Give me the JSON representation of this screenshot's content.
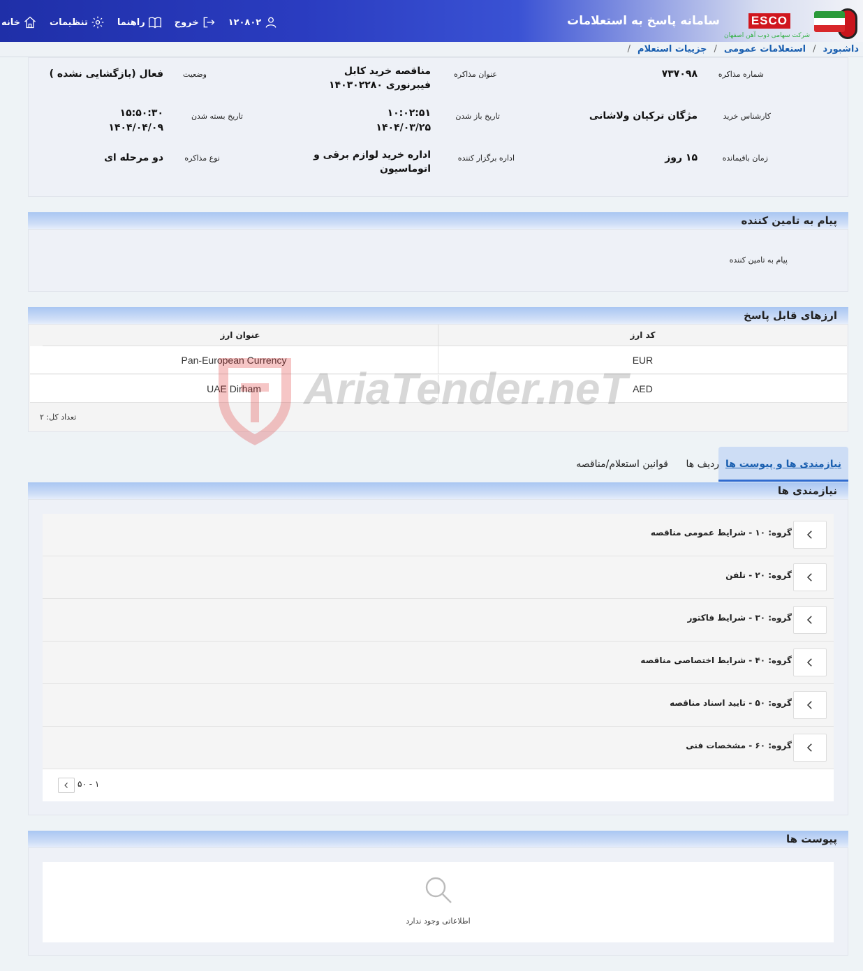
{
  "header": {
    "brand_short": "ESCO",
    "brand_sub": "شرکت سهامی ذوب آهن اصفهان",
    "system_title": "سامانه پاسخ به استعلامات",
    "nav": {
      "home": "خانه",
      "settings": "تنظیمات",
      "guide": "راهنما",
      "logout": "خروج",
      "user_id": "۱۲۰۸۰۲"
    }
  },
  "breadcrumb": [
    "داشبورد",
    "استعلامات عمومی",
    "جزییات استعلام"
  ],
  "info": {
    "negotiation_number_label": "شماره مذاکره",
    "negotiation_number": "۷۳۷۰۹۸",
    "title_label": "عنوان مذاکره",
    "title": "مناقصه خرید کابل فیبرنوری ۱۴۰۳۰۲۲۸۰",
    "status_label": "وضعیت",
    "status": "فعال (بازگشایی نشده )",
    "buyer_label": "کارشناس خرید",
    "buyer": "مژگان ترکیان ولاشانی",
    "open_date_label": "تاریخ باز شدن",
    "open_time": "۱۰:۰۲:۵۱",
    "open_date": "۱۴۰۴/۰۳/۲۵",
    "close_date_label": "تاریخ بسته شدن",
    "close_time": "۱۵:۵۰:۳۰",
    "close_date": "۱۴۰۴/۰۴/۰۹",
    "remaining_label": "زمان باقیمانده",
    "remaining": "۱۵ روز",
    "organizer_label": "اداره برگزار کننده",
    "organizer": "اداره خرید لوازم برقی و اتوماسیون",
    "type_label": "نوع مذاکره",
    "type": "دو مرحله ای"
  },
  "message": {
    "title": "پیام به تامین کننده",
    "label": "پیام به تامین کننده"
  },
  "currencies": {
    "title": "ارزهای قابل پاسخ",
    "col_code": "کد ارز",
    "col_name": "عنوان ارز",
    "rows": [
      {
        "code": "EUR",
        "name": "Pan-European Currency"
      },
      {
        "code": "AED",
        "name": "UAE Dirham"
      }
    ],
    "count": "تعداد کل: ۲"
  },
  "tabs": [
    "نیازمندی ها و پیوست ها",
    "ردیف ها",
    "قوانین استعلام/مناقصه"
  ],
  "needs": {
    "title": "نیازمندی ها",
    "groups": [
      "گروه: ۱۰ - شرایط عمومی مناقصه",
      "گروه: ۲۰ - تلفن",
      "گروه: ۳۰ - شرایط فاکتور",
      "گروه: ۴۰ - شرایط اختصاصی مناقصه",
      "گروه: ۵۰ - تایید اسناد مناقصه",
      "گروه: ۶۰ - مشخصات فنی"
    ],
    "pager": "۱ - ۵۰"
  },
  "attachments": {
    "title": "پیوست ها",
    "empty": "اطلاعاتی وجود ندارد"
  },
  "watermark": "AriaTender.neT"
}
